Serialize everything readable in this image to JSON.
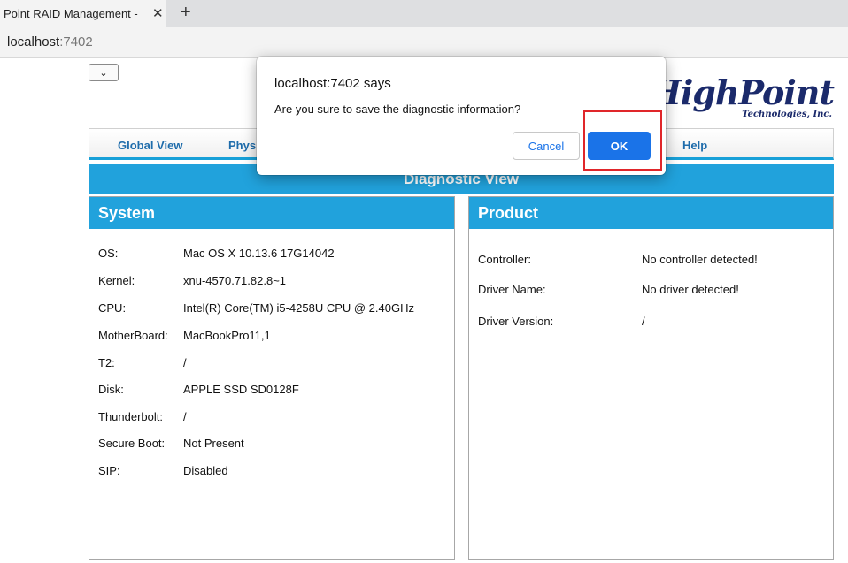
{
  "browser": {
    "tab_title": "Point RAID Management -",
    "close_glyph": "✕",
    "new_tab_glyph": "+",
    "url_host": "localhost",
    "url_port": ":7402"
  },
  "page": {
    "language_select_glyph": "⌄",
    "logo": {
      "main": "HighPoint",
      "sub": "Technologies, Inc."
    },
    "nav": {
      "global_view": "Global View",
      "physical": "Physi",
      "help": "Help"
    },
    "view_title": "Diagnostic View"
  },
  "system": {
    "header": "System",
    "rows": [
      {
        "label": "OS:",
        "value": "Mac OS X 10.13.6 17G14042"
      },
      {
        "label": "Kernel:",
        "value": "xnu-4570.71.82.8~1"
      },
      {
        "label": "CPU:",
        "value": "Intel(R) Core(TM) i5-4258U CPU @ 2.40GHz"
      },
      {
        "label": "MotherBoard:",
        "value": "MacBookPro11,1"
      },
      {
        "label": "T2:",
        "value": "/"
      },
      {
        "label": "Disk:",
        "value": "APPLE SSD SD0128F"
      },
      {
        "label": "Thunderbolt:",
        "value": "/"
      },
      {
        "label": "Secure Boot:",
        "value": "Not Present"
      },
      {
        "label": "SIP:",
        "value": "Disabled"
      }
    ]
  },
  "product": {
    "header": "Product",
    "rows": [
      {
        "label": "Controller:",
        "value": "No controller detected!"
      },
      {
        "label": "Driver Name:",
        "value": "No driver detected!"
      },
      {
        "label": "Driver Version:",
        "value": "/"
      }
    ]
  },
  "dialog": {
    "title": "localhost:7402 says",
    "message": "Are you sure to save the diagnostic information?",
    "cancel_label": "Cancel",
    "ok_label": "OK"
  },
  "colors": {
    "accent_blue": "#21a2dc",
    "dialog_button_blue": "#1a73e8",
    "highlight_red": "#e0262a"
  }
}
